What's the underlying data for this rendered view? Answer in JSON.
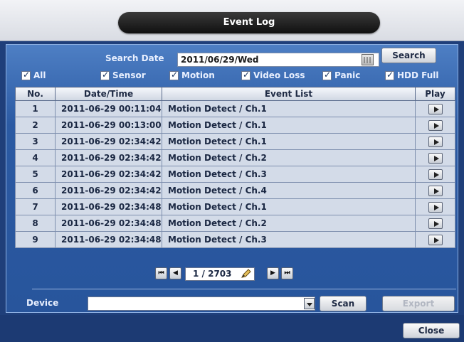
{
  "window": {
    "title": "Event Log"
  },
  "search": {
    "label": "Search Date",
    "date_value": "2011/06/29/Wed",
    "search_button": "Search"
  },
  "filters": [
    {
      "label": "All",
      "checked": true
    },
    {
      "label": "Sensor",
      "checked": true
    },
    {
      "label": "Motion",
      "checked": true
    },
    {
      "label": "Video Loss",
      "checked": true
    },
    {
      "label": "Panic",
      "checked": true
    },
    {
      "label": "HDD Full",
      "checked": true
    }
  ],
  "table": {
    "headers": [
      "No.",
      "Date/Time",
      "Event List",
      "Play"
    ],
    "rows": [
      {
        "no": "1",
        "datetime": "2011-06-29 00:11:04",
        "event": "Motion Detect  / Ch.1"
      },
      {
        "no": "2",
        "datetime": "2011-06-29 00:13:00",
        "event": "Motion Detect  / Ch.1"
      },
      {
        "no": "3",
        "datetime": "2011-06-29 02:34:42",
        "event": "Motion Detect  / Ch.1"
      },
      {
        "no": "4",
        "datetime": "2011-06-29 02:34:42",
        "event": "Motion Detect  / Ch.2"
      },
      {
        "no": "5",
        "datetime": "2011-06-29 02:34:42",
        "event": "Motion Detect  / Ch.3"
      },
      {
        "no": "6",
        "datetime": "2011-06-29 02:34:42",
        "event": "Motion Detect  / Ch.4"
      },
      {
        "no": "7",
        "datetime": "2011-06-29 02:34:48",
        "event": "Motion Detect  / Ch.1"
      },
      {
        "no": "8",
        "datetime": "2011-06-29 02:34:48",
        "event": "Motion Detect  / Ch.2"
      },
      {
        "no": "9",
        "datetime": "2011-06-29 02:34:48",
        "event": "Motion Detect  / Ch.3"
      }
    ]
  },
  "pager": {
    "page_text": "1 / 2703"
  },
  "device": {
    "label": "Device",
    "value": "",
    "scan_button": "Scan",
    "export_button": "Export"
  },
  "footer": {
    "close_button": "Close"
  },
  "icons": {
    "calendar": "calendar-icon",
    "first_page": "first-page-icon",
    "prev_page": "prev-page-icon",
    "next_page": "next-page-icon",
    "last_page": "last-page-icon",
    "goto": "pencil-icon",
    "play": "play-icon",
    "dropdown": "chevron-down-icon"
  },
  "colors": {
    "panel": "#2b5aa3",
    "title_pill": "#101010"
  }
}
